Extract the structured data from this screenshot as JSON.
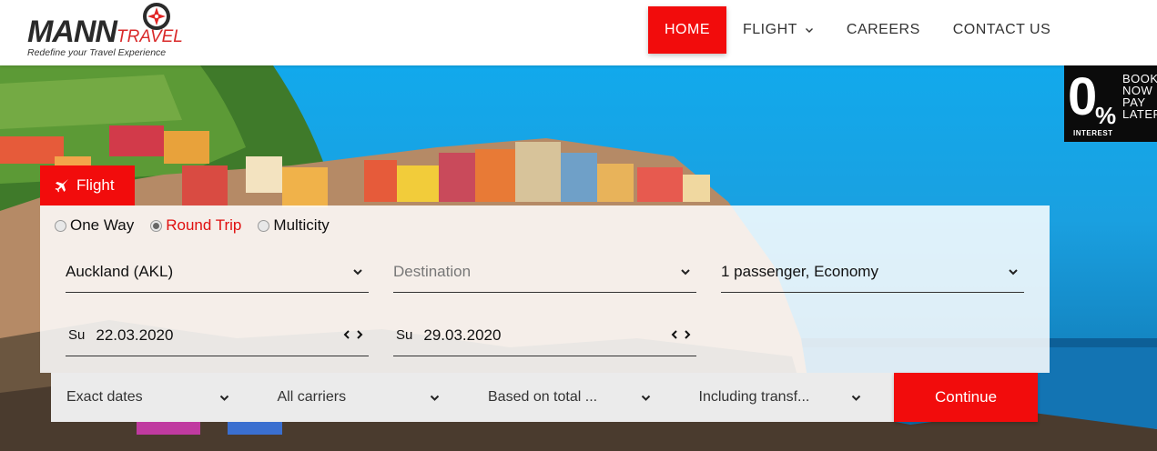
{
  "brand": {
    "name_main": "MANN",
    "name_sub": "TRAVEL",
    "tagline": "Redefine your Travel Experience"
  },
  "nav": {
    "items": [
      {
        "label": "HOME",
        "active": true
      },
      {
        "label": "FLIGHT",
        "has_dropdown": true
      },
      {
        "label": "CAREERS"
      },
      {
        "label": "CONTACT US"
      }
    ]
  },
  "promo": {
    "zero": "0",
    "pct": "%",
    "line1": "BOOK",
    "line2": "NOW",
    "line3": "PAY",
    "line4": "LATER",
    "interest": "INTEREST"
  },
  "search": {
    "tab_label": "Flight",
    "trip_types": [
      "One Way",
      "Round Trip",
      "Multicity"
    ],
    "selected_trip": "Round Trip",
    "origin": "Auckland (AKL)",
    "destination_placeholder": "Destination",
    "passengers": "1 passenger, Economy",
    "depart_day": "Su",
    "depart_date": "22.03.2020",
    "return_day": "Su",
    "return_date": "29.03.2020",
    "arrows_label": "‹ ›"
  },
  "filters": {
    "dates": "Exact dates",
    "carriers": "All carriers",
    "price": "Based on total ...",
    "transfers": "Including transf..."
  },
  "actions": {
    "continue_label": "Continue"
  },
  "colors": {
    "accent": "#f20c0c",
    "sky": "#12a9ec",
    "panel_bg": "#ffffff"
  }
}
